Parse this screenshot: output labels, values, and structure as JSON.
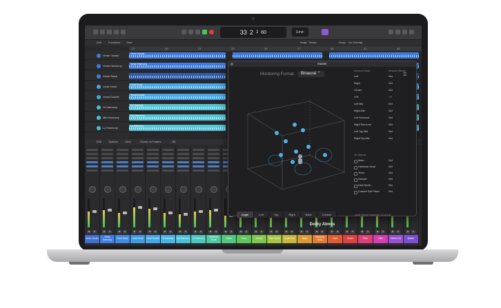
{
  "control_bar": {
    "bar": "33",
    "beat": "2",
    "sub": "2",
    "tempo": "60",
    "key": "Emin",
    "lcd_sub_labels": [
      "BAR",
      "BEAT",
      "TEMPO"
    ]
  },
  "menus": {
    "edit": "Edit",
    "functions": "Functions",
    "view": "View",
    "snap": "Snap:",
    "snap_value": "Smart",
    "drag": "Drag:",
    "drag_value": "No Overlap"
  },
  "ruler_marks": [
    "27",
    "29",
    "31",
    "33",
    "35",
    "37",
    "39",
    "41",
    "43"
  ],
  "tracks": [
    {
      "name": "Verse Vocals",
      "color": "#3f7de0"
    },
    {
      "name": "Verse Harmony",
      "color": "#3f7de0"
    },
    {
      "name": "Vocal Stack",
      "color": "#3f7de0"
    },
    {
      "name": "Lead Vocal",
      "color": "#42a7e6"
    },
    {
      "name": "Vocal Double",
      "color": "#42a7e6"
    },
    {
      "name": "Hi Harmony",
      "color": "#48c1d8"
    },
    {
      "name": "Mid Harmony",
      "color": "#48c1d8"
    },
    {
      "name": "Lo Harmony",
      "color": "#48c1d8"
    }
  ],
  "regions": [
    {
      "label": "Verse Vocals",
      "color": "#3f7de0"
    },
    {
      "label": "Verse Harmony",
      "color": "#3f7de0"
    },
    {
      "label": "",
      "color": "#2f5fae"
    },
    {
      "label": "Lead Vocal",
      "color": "#4aa9e8"
    },
    {
      "label": "Vocal Double",
      "color": "#4aa9e8"
    },
    {
      "label": "Hi Harmony",
      "color": "#56c6d9"
    },
    {
      "label": "Mid Harmony",
      "color": "#56c6d9"
    },
    {
      "label": "Lo Harmony",
      "color": "#56c6d9"
    }
  ],
  "mixer": {
    "header": [
      "Edit",
      "Options",
      "View",
      "Sends on Faders",
      "Off"
    ],
    "strips": [
      {
        "name": "Verse Vocals",
        "color": "#3f6fd1",
        "level": 0.55
      },
      {
        "name": "Verse Harmony",
        "color": "#3f7de0",
        "level": 0.6
      },
      {
        "name": "Vocal Stack",
        "color": "#3f8ae0",
        "level": 0.5
      },
      {
        "name": "Lead Vocal",
        "color": "#3f9ae4",
        "level": 0.7
      },
      {
        "name": "Vocal Double",
        "color": "#42a7e6",
        "level": 0.65
      },
      {
        "name": "Hi Harmony",
        "color": "#46b4e6",
        "level": 0.5
      },
      {
        "name": "Mid Harmony",
        "color": "#48c1d8",
        "level": 0.45
      },
      {
        "name": "Lo Harmony",
        "color": "#4ac6c1",
        "level": 0.55
      },
      {
        "name": "Harmony Vocal",
        "color": "#4ec6a0",
        "level": 0.6
      },
      {
        "name": "Guitar",
        "color": "#52c67e",
        "level": 0.4
      },
      {
        "name": "Tenor",
        "color": "#5ec65c",
        "level": 0.5
      },
      {
        "name": "Sample",
        "color": "#7ec64c",
        "level": 0.55
      },
      {
        "name": "Dark Synth",
        "color": "#a6c640",
        "level": 0.45
      },
      {
        "name": "Synth Pad",
        "color": "#c6b83c",
        "level": 0.5
      },
      {
        "name": "Bass",
        "color": "#d89a36",
        "level": 0.6
      },
      {
        "name": "Harmony Vocal",
        "color": "#e07a34",
        "level": 0.45
      },
      {
        "name": "Kick",
        "color": "#e05a34",
        "level": 0.7
      },
      {
        "name": "Snare",
        "color": "#e04040",
        "level": 0.55
      },
      {
        "name": "Perc",
        "color": "#e0407a",
        "level": 0.5
      },
      {
        "name": "Hats",
        "color": "#d040b0",
        "level": 0.45
      },
      {
        "name": "Stereo Out",
        "color": "#9a50d0",
        "level": 0.75
      },
      {
        "name": "Master",
        "color": "#7a50d0",
        "level": 0.8
      }
    ]
  },
  "master_window": {
    "title": "Master",
    "monitoring_label": "Monitoring Format:",
    "monitoring_value": "Binaural",
    "bed_header": "Surround Beds",
    "render_header": "Binaural Render",
    "bed_rows": [
      {
        "name": "Left",
        "value": "Mid"
      },
      {
        "name": "Right",
        "value": "Mid"
      },
      {
        "name": "Center",
        "value": "Mid"
      },
      {
        "name": "LFE",
        "value": "Off"
      },
      {
        "name": "Left Mid",
        "value": "Mid"
      },
      {
        "name": "Right Mid",
        "value": "Mid"
      },
      {
        "name": "Left Surround",
        "value": "Mid"
      },
      {
        "name": "Right Surround",
        "value": "Mid"
      },
      {
        "name": "Left Top Mid",
        "value": "Mid"
      },
      {
        "name": "Right Top Mid",
        "value": "Mid"
      }
    ],
    "objects_header": "3D Objects",
    "object_rows": [
      {
        "name": "Main...",
        "value": "Mid"
      },
      {
        "name": "Harmony Vocal",
        "value": "Mid"
      },
      {
        "name": "Tenor",
        "value": "Mid"
      },
      {
        "name": "Sample",
        "value": "Mid"
      },
      {
        "name": "Dark Synth...",
        "value": "Mid"
      },
      {
        "name": "Custom Soft Piano",
        "value": "Mid"
      }
    ],
    "view_buttons": [
      "Angle",
      "Left",
      "Top",
      "Right",
      "Back",
      "Custom"
    ],
    "object_channels": "Input Object Channels: 12 of 118",
    "brand": "Dolby Atmos"
  }
}
